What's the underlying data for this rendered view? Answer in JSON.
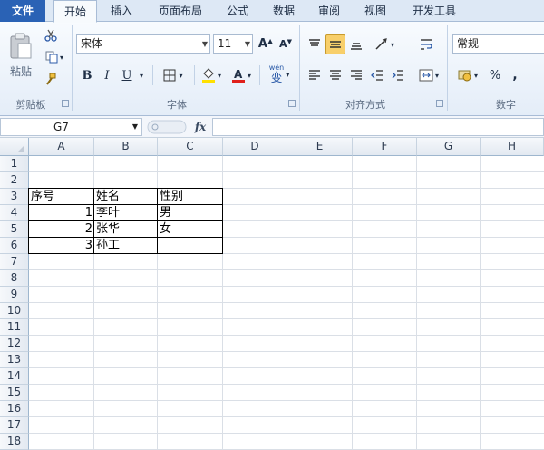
{
  "tabs": {
    "file": "文件",
    "home": "开始",
    "insert": "插入",
    "page_layout": "页面布局",
    "formulas": "公式",
    "data": "数据",
    "review": "审阅",
    "view": "视图",
    "developer": "开发工具"
  },
  "ribbon": {
    "clipboard": {
      "paste_label": "粘贴",
      "group_label": "剪贴板"
    },
    "font": {
      "font_name": "宋体",
      "font_size": "11",
      "bold": "B",
      "italic": "I",
      "underline": "U",
      "group_label": "字体",
      "wen_label": "wén",
      "wen_char": "变"
    },
    "alignment": {
      "group_label": "对齐方式"
    },
    "number": {
      "format": "常规",
      "percent": "%",
      "comma": ",",
      "group_label": "数字"
    }
  },
  "formula_bar": {
    "name_box": "G7",
    "fx": "fx",
    "formula": ""
  },
  "grid": {
    "columns": [
      "A",
      "B",
      "C",
      "D",
      "E",
      "F",
      "G",
      "H"
    ],
    "rows": [
      "1",
      "2",
      "3",
      "4",
      "5",
      "6",
      "7",
      "8",
      "9",
      "10",
      "11",
      "12",
      "13",
      "14",
      "15",
      "16",
      "17",
      "18"
    ],
    "cells": {
      "A3": "序号",
      "B3": "姓名",
      "C3": "性别",
      "A4": "1",
      "B4": "李叶",
      "C4": "男",
      "A5": "2",
      "B5": "张华",
      "C5": "女",
      "A6": "3",
      "B6": "孙工",
      "C6": ""
    }
  },
  "colors": {
    "file_tab": "#2a62b5",
    "ribbon_bg": "#e4edf8",
    "font_color_accent": "#e0201b",
    "highlight_accent": "#ffe000",
    "selected_align": "#f8cf6a"
  }
}
